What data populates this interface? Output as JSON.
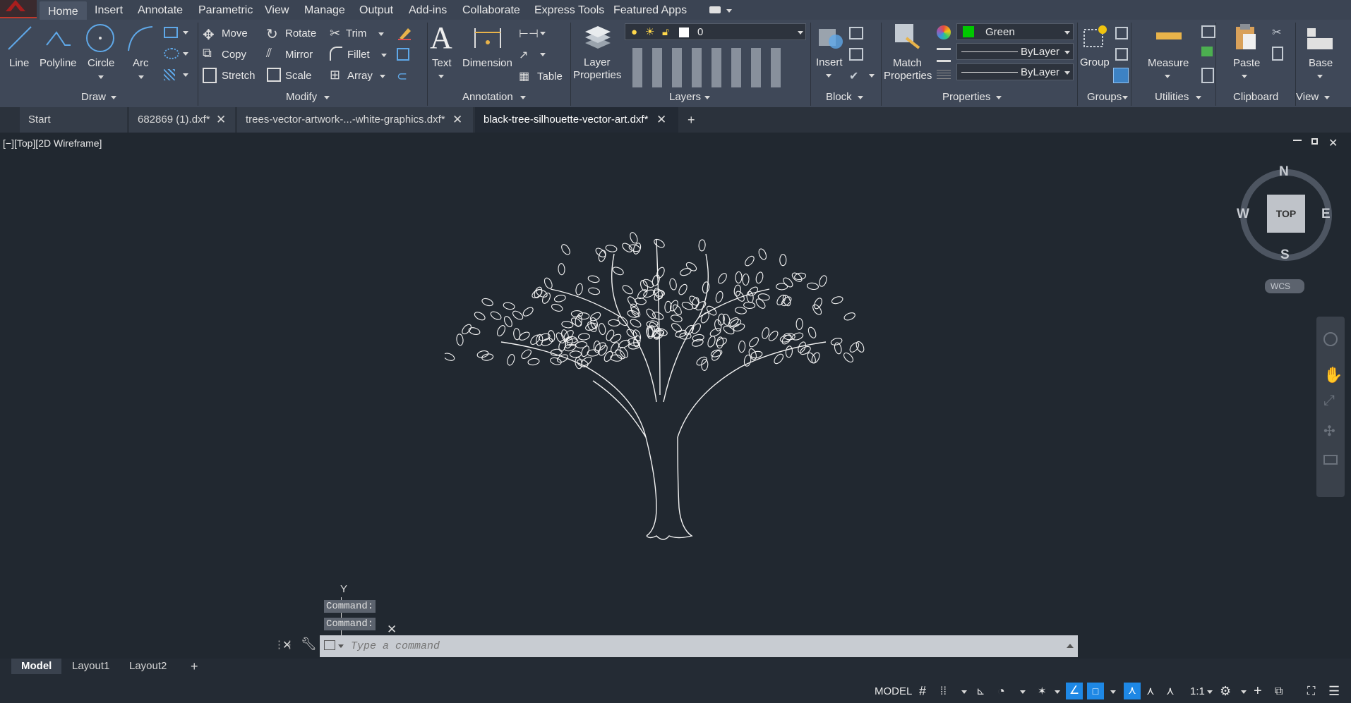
{
  "menu": {
    "tabs": [
      "Home",
      "Insert",
      "Annotate",
      "Parametric",
      "View",
      "Manage",
      "Output",
      "Add-ins",
      "Collaborate",
      "Express Tools",
      "Featured Apps"
    ]
  },
  "ribbon": {
    "draw": {
      "line": "Line",
      "polyline": "Polyline",
      "circle": "Circle",
      "arc": "Arc",
      "title": "Draw"
    },
    "modify": {
      "move": "Move",
      "rotate": "Rotate",
      "trim": "Trim",
      "copy": "Copy",
      "mirror": "Mirror",
      "fillet": "Fillet",
      "stretch": "Stretch",
      "scale": "Scale",
      "array": "Array",
      "title": "Modify"
    },
    "annotation": {
      "text": "Text",
      "dimension": "Dimension",
      "table": "Table",
      "title": "Annotation"
    },
    "layers": {
      "layer_properties_1": "Layer",
      "layer_properties_2": "Properties",
      "current_layer": "0",
      "title": "Layers"
    },
    "block": {
      "insert": "Insert",
      "title": "Block"
    },
    "properties": {
      "match_1": "Match",
      "match_2": "Properties",
      "color": "Green",
      "linetype": "ByLayer",
      "lineweight": "ByLayer",
      "title": "Properties"
    },
    "groups": {
      "group": "Group",
      "title": "Groups"
    },
    "utilities": {
      "measure": "Measure",
      "title": "Utilities"
    },
    "clipboard": {
      "paste": "Paste",
      "title": "Clipboard"
    },
    "view": {
      "base": "Base",
      "title": "View"
    }
  },
  "doc_tabs": [
    "Start",
    "682869 (1).dxf*",
    "trees-vector-artwork-...-white-graphics.dxf*",
    "black-tree-silhouette-vector-art.dxf*"
  ],
  "viewport": {
    "label": "[−][Top][2D Wireframe]",
    "viewcube": {
      "face": "TOP",
      "n": "N",
      "s": "S",
      "e": "E",
      "w": "W",
      "ucs": "WCS"
    },
    "y_axis": "Y"
  },
  "command": {
    "history": [
      "Command:",
      "Command:"
    ],
    "placeholder": "Type a command"
  },
  "layout_tabs": [
    "Model",
    "Layout1",
    "Layout2"
  ],
  "status": {
    "model": "MODEL",
    "scale": "1:1"
  },
  "colors": {
    "accent": "#1e88e5",
    "layer_green": "#00c800",
    "ribbon_bg": "#3f4858",
    "canvas_bg": "#212830"
  }
}
